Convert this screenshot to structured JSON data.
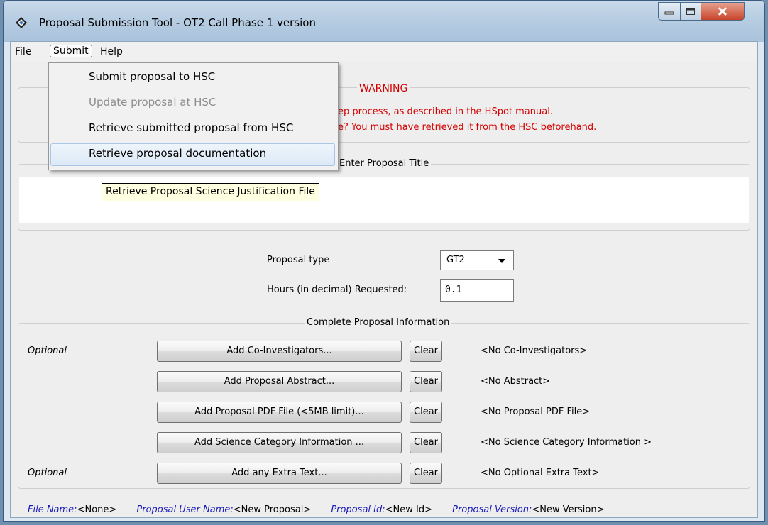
{
  "window": {
    "title": "Proposal Submission Tool - OT2 Call Phase 1 version"
  },
  "menubar": {
    "file": "File",
    "submit": "Submit",
    "help": "Help"
  },
  "submit_menu": {
    "items": [
      "Submit proposal to HSC",
      "Update proposal at HSC",
      "Retrieve submitted proposal from HSC",
      "Retrieve proposal documentation"
    ],
    "tooltip": "Retrieve Proposal Science Justification File"
  },
  "warning": {
    "title": "WARNING",
    "line1": "ep process, as described in the HSpot manual.",
    "line2": "e? You must have retrieved it from the HSC beforehand."
  },
  "proposal_title": {
    "legend": "Enter Proposal Title",
    "value": ""
  },
  "proposal_type": {
    "label": "Proposal type",
    "value": "GT2"
  },
  "hours": {
    "label": "Hours (in decimal) Requested:",
    "value": "0.1"
  },
  "info": {
    "legend": "Complete Proposal Information",
    "clear_label": "Clear",
    "rows": [
      {
        "optional": "Optional",
        "button": "Add Co-Investigators...",
        "status": "<No Co-Investigators>"
      },
      {
        "optional": "",
        "button": "Add Proposal Abstract...",
        "status": "<No Abstract>"
      },
      {
        "optional": "",
        "button": "Add Proposal PDF File (<5MB limit)...",
        "status": "<No Proposal PDF File>"
      },
      {
        "optional": "",
        "button": "Add Science Category Information ...",
        "status": "<No Science Category Information >"
      },
      {
        "optional": "Optional",
        "button": "Add any Extra Text...",
        "status": "<No Optional Extra Text>"
      }
    ]
  },
  "footer": {
    "file_name_key": "File Name:",
    "file_name_val": "<None>",
    "user_key": "Proposal User Name:",
    "user_val": "<New Proposal>",
    "id_key": "Proposal Id:",
    "id_val": "<New Id>",
    "version_key": "Proposal Version:",
    "version_val": "<New Version>"
  },
  "icons": [
    "app-diamond-icon",
    "minimize-icon",
    "maximize-icon",
    "close-icon",
    "dropdown-arrow-icon"
  ]
}
